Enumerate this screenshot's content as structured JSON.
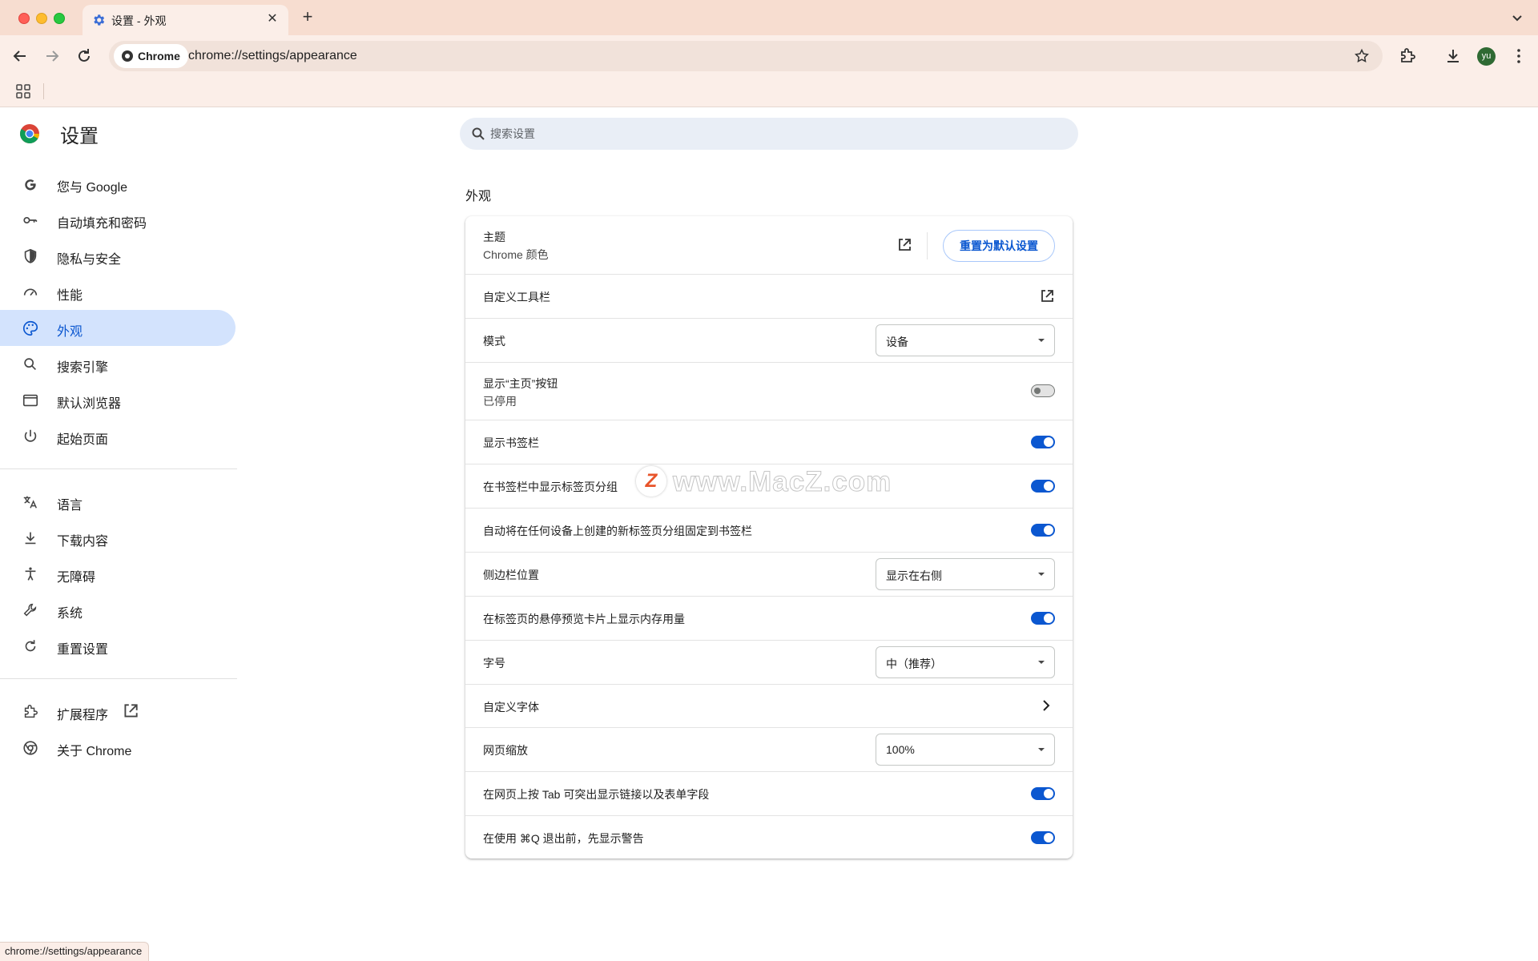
{
  "window": {
    "tab": {
      "title": "设置 - 外观",
      "favicon": "gear-icon"
    },
    "new_tab_label": "+",
    "close_glyph": "✕"
  },
  "toolbar": {
    "chip_label": "Chrome",
    "url": "chrome://settings/appearance",
    "avatar_text": "yu",
    "avatar_color": "#2f6a33"
  },
  "sidebar": {
    "title": "设置",
    "groups": [
      [
        {
          "label": "您与 Google",
          "icon": "google-g-icon"
        },
        {
          "label": "自动填充和密码",
          "icon": "key-icon"
        },
        {
          "label": "隐私与安全",
          "icon": "shield-icon"
        },
        {
          "label": "性能",
          "icon": "speedometer-icon"
        },
        {
          "label": "外观",
          "icon": "palette-icon",
          "active": true
        },
        {
          "label": "搜索引擎",
          "icon": "search-icon"
        },
        {
          "label": "默认浏览器",
          "icon": "browser-window-icon"
        },
        {
          "label": "起始页面",
          "icon": "power-icon"
        }
      ],
      [
        {
          "label": "语言",
          "icon": "translate-icon"
        },
        {
          "label": "下载内容",
          "icon": "download-icon"
        },
        {
          "label": "无障碍",
          "icon": "accessibility-icon"
        },
        {
          "label": "系统",
          "icon": "wrench-icon"
        },
        {
          "label": "重置设置",
          "icon": "reset-icon"
        }
      ],
      [
        {
          "label": "扩展程序",
          "icon": "puzzle-icon",
          "external": true
        },
        {
          "label": "关于 Chrome",
          "icon": "chrome-icon"
        }
      ]
    ]
  },
  "search": {
    "placeholder": "搜索设置"
  },
  "section": {
    "title": "外观"
  },
  "rows": {
    "theme": {
      "label": "主题",
      "sub": "Chrome 颜色",
      "button": "重置为默认设置"
    },
    "toolbar": {
      "label": "自定义工具栏"
    },
    "mode": {
      "label": "模式",
      "value": "设备"
    },
    "home_button": {
      "label": "显示“主页”按钮",
      "sub": "已停用",
      "on": false
    },
    "bookmarks_bar": {
      "label": "显示书签栏",
      "on": true
    },
    "tab_groups": {
      "label": "在书签栏中显示标签页分组",
      "on": true
    },
    "pin_groups": {
      "label": "自动将在任何设备上创建的新标签页分组固定到书签栏",
      "on": true
    },
    "side_panel": {
      "label": "侧边栏位置",
      "value": "显示在右侧"
    },
    "memory": {
      "label": "在标签页的悬停预览卡片上显示内存用量",
      "on": true
    },
    "font_size": {
      "label": "字号",
      "value": "中（推荐）"
    },
    "fonts": {
      "label": "自定义字体"
    },
    "zoom": {
      "label": "网页缩放",
      "value": "100%"
    },
    "tab_highlight": {
      "label": "在网页上按 Tab 可突出显示链接以及表单字段",
      "on": true
    },
    "quit_warning": {
      "label": "在使用 ⌘Q 退出前，先显示警告",
      "on": true
    }
  },
  "watermark": {
    "badge": "Z",
    "text": "www.MacZ.com"
  },
  "status_bar": {
    "url": "chrome://settings/appearance"
  },
  "colors": {
    "accent": "#0b57d0",
    "active_bg": "#d3e3fd",
    "frame": "#f7ddd0"
  }
}
